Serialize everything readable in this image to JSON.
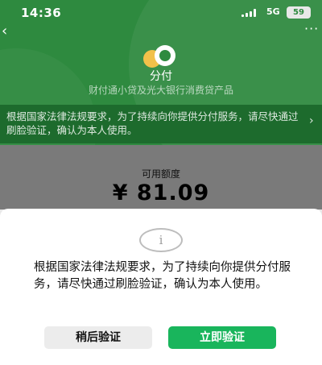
{
  "status_bar": {
    "time": "14:36",
    "network": "5G",
    "battery": "59"
  },
  "header": {
    "back_icon": "chevron-left-icon",
    "more_icon": "ellipsis-icon",
    "brand_name": "分付",
    "brand_subtitle": "财付通小贷及光大银行消费贷产品"
  },
  "notice": {
    "text": "根据国家法律法规要求，为了持续向你提供分付服务，请尽快通过刷脸验证，确认为本人使用。",
    "chevron_icon": "chevron-right-icon"
  },
  "balance": {
    "label": "可用额度",
    "amount": "¥ 81.09"
  },
  "dialog": {
    "icon": "info-icon",
    "icon_glyph": "i",
    "message": "根据国家法律法规要求，为了持续向你提供分付服务，请尽快通过刷脸验证，确认为本人使用。",
    "later_label": "稍后验证",
    "now_label": "立即验证"
  },
  "colors": {
    "brand_green": "#2e8a3f",
    "button_green": "#19b55c"
  }
}
